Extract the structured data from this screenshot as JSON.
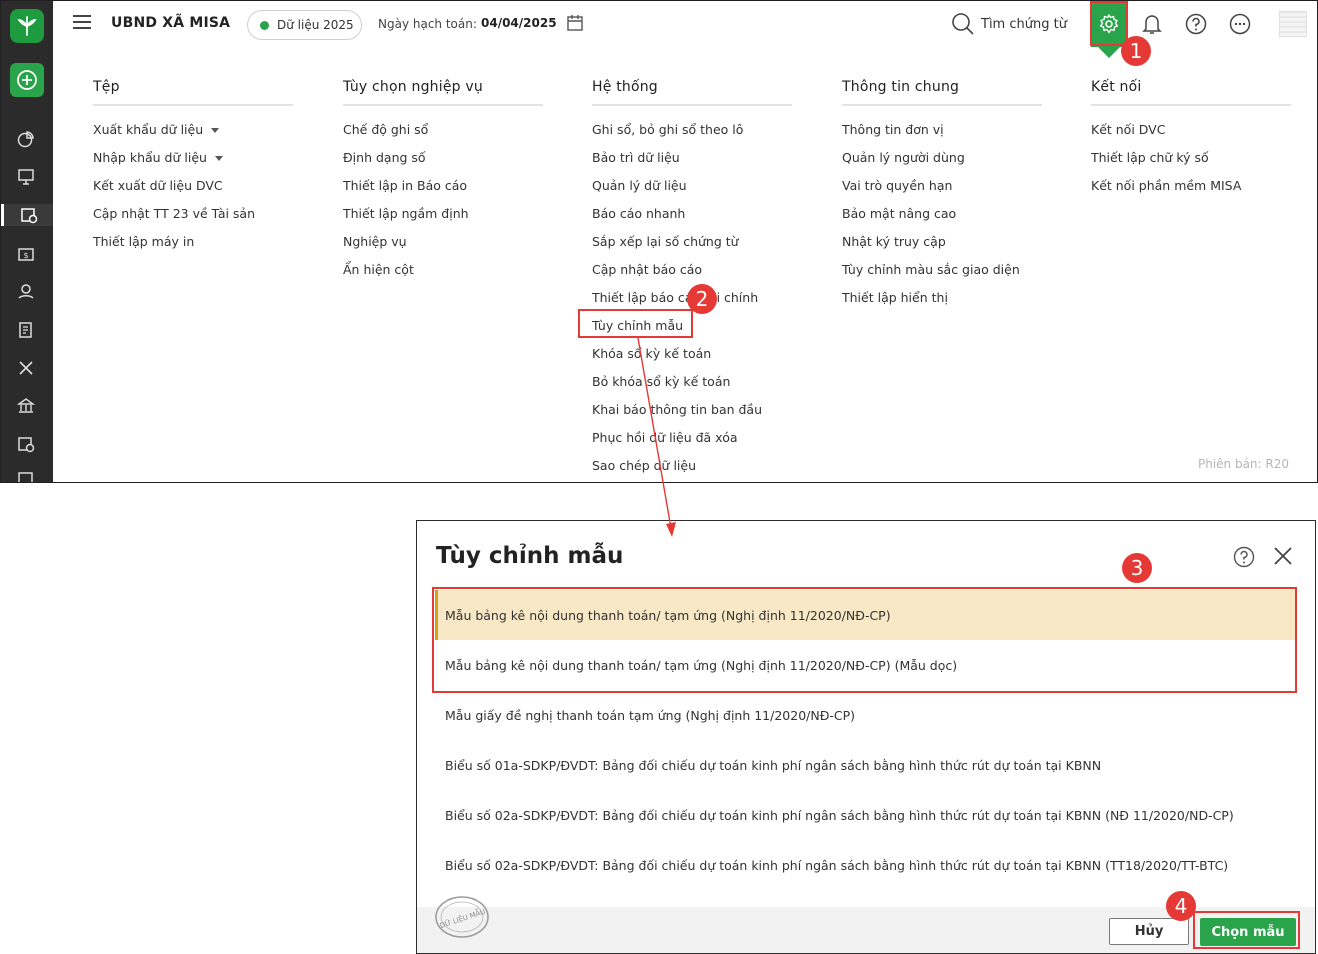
{
  "header": {
    "org_name": "UBND XÃ MISA",
    "data_year": "Dữ liệu 2025",
    "accounting_date_label": "Ngày hạch toán:",
    "accounting_date": "04/04/2025",
    "search_placeholder": "Tìm chứng từ"
  },
  "menu": {
    "columns": [
      {
        "title": "Tệp",
        "items": [
          "Xuất khẩu dữ liệu",
          "Nhập khẩu dữ liệu",
          "Kết xuất dữ liệu DVC",
          "Cập nhật TT 23 về Tài sản",
          "Thiết lập máy in"
        ]
      },
      {
        "title": "Tùy chọn nghiệp vụ",
        "items": [
          "Chế độ ghi sổ",
          "Định dạng số",
          "Thiết lập in Báo cáo",
          "Thiết lập ngầm định",
          "Nghiệp vụ",
          "Ẩn hiện cột"
        ]
      },
      {
        "title": "Hệ thống",
        "items": [
          "Ghi sổ, bỏ ghi sổ theo lô",
          "Bảo trì dữ liệu",
          "Quản lý dữ liệu",
          "Báo cáo nhanh",
          "Sắp xếp lại số chứng từ",
          "Cập nhật báo cáo",
          "Thiết lập báo cáo tài chính",
          "Tùy chỉnh mẫu",
          "Khóa sổ kỳ kế toán",
          "Bỏ khóa sổ kỳ kế toán",
          "Khai báo thông tin ban đầu",
          "Phục hồi dữ liệu đã xóa",
          "Sao chép dữ liệu"
        ]
      },
      {
        "title": "Thông tin chung",
        "items": [
          "Thông tin đơn vị",
          "Quản lý người dùng",
          "Vai trò quyền hạn",
          "Bảo mật nâng cao",
          "Nhật ký truy cập",
          "Tùy chỉnh màu sắc giao diện",
          "Thiết lập hiển thị"
        ]
      },
      {
        "title": "Kết nối",
        "items": [
          "Kết nối DVC",
          "Thiết lập chữ ký số",
          "Kết nối phần mềm MISA"
        ]
      }
    ],
    "version": "Phiên bản: R20"
  },
  "dialog": {
    "title": "Tùy chỉnh mẫu",
    "templates": [
      "Mẫu bảng kê nội dung thanh toán/ tạm ứng (Nghị định 11/2020/NĐ-CP)",
      "Mẫu bảng kê nội dung thanh toán/ tạm ứng (Nghị định 11/2020/NĐ-CP) (Mẫu dọc)",
      "Mẫu giấy đề nghị thanh toán tạm ứng (Nghị định 11/2020/NĐ-CP)",
      "Biểu số 01a-SDKP/ĐVDT: Bảng đối chiếu dự toán kinh phí ngân sách bằng hình thức rút dự toán tại KBNN",
      "Biểu số 02a-SDKP/ĐVDT: Bảng đối chiếu dự toán kinh phí ngân sách bằng hình thức rút dự toán tại KBNN (NĐ 11/2020/ND-CP)",
      "Biểu số 02a-SDKP/ĐVDT: Bảng đối chiếu dự toán kinh phí ngân sách bằng hình thức rút dự toán tại KBNN (TT18/2020/TT-BTC)"
    ],
    "cancel_label": "Hủy",
    "ok_label": "Chọn mẫu",
    "stamp_text": "DỮ LIỆU MẪU"
  },
  "annotations": {
    "step1": "1",
    "step2": "2",
    "step3": "3",
    "step4": "4"
  },
  "colors": {
    "accent": "#2aa44a",
    "highlight": "#e53935",
    "selected_row": "#f8e8c6",
    "rail": "#2b2b2b"
  }
}
